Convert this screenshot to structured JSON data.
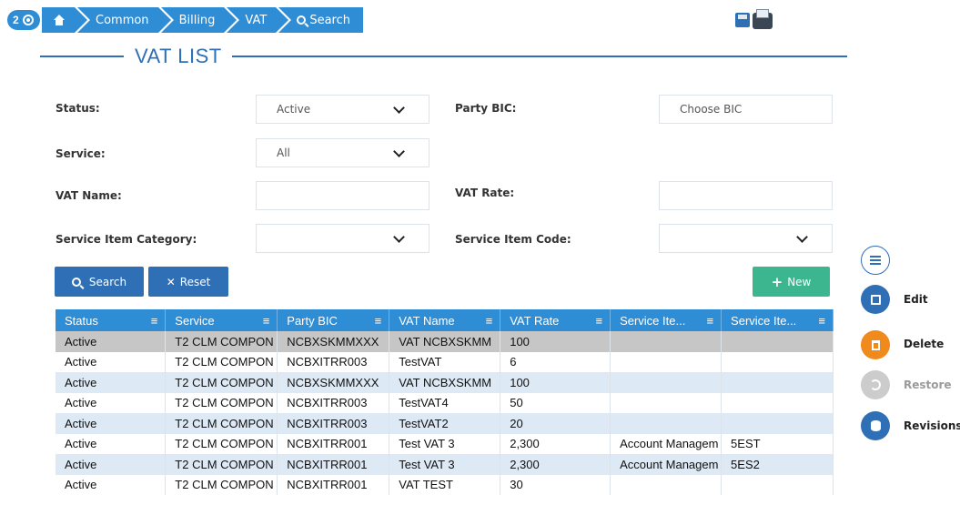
{
  "badge": {
    "count": "2"
  },
  "breadcrumb": {
    "items": [
      "Common",
      "Billing",
      "VAT"
    ],
    "last": "Search"
  },
  "page_title": "VAT LIST",
  "form": {
    "status": {
      "label": "Status:",
      "value": "Active"
    },
    "party_bic": {
      "label": "Party BIC:",
      "placeholder": "Choose BIC"
    },
    "service": {
      "label": "Service:",
      "value": "All"
    },
    "vat_name": {
      "label": "VAT Name:",
      "value": ""
    },
    "vat_rate": {
      "label": "VAT Rate:",
      "value": ""
    },
    "service_item_category": {
      "label": "Service Item Category:",
      "value": ""
    },
    "service_item_code": {
      "label": "Service Item Code:",
      "value": ""
    }
  },
  "buttons": {
    "search": "Search",
    "reset": "Reset",
    "new": "New"
  },
  "table": {
    "headers": [
      "Status",
      "Service",
      "Party BIC",
      "VAT Name",
      "VAT Rate",
      "Service Ite...",
      "Service Ite..."
    ],
    "rows": [
      [
        "Active",
        "T2 CLM COMPON",
        "NCBXSKMMXXX",
        "VAT NCBXSKMM",
        "100",
        "",
        ""
      ],
      [
        "Active",
        "T2 CLM COMPON",
        "NCBXITRR003",
        "TestVAT",
        "6",
        "",
        ""
      ],
      [
        "Active",
        "T2 CLM COMPON",
        "NCBXSKMMXXX",
        "VAT NCBXSKMM",
        "100",
        "",
        ""
      ],
      [
        "Active",
        "T2 CLM COMPON",
        "NCBXITRR003",
        "TestVAT4",
        "50",
        "",
        ""
      ],
      [
        "Active",
        "T2 CLM COMPON",
        "NCBXITRR003",
        "TestVAT2",
        "20",
        "",
        ""
      ],
      [
        "Active",
        "T2 CLM COMPON",
        "NCBXITRR001",
        "Test VAT 3",
        "2,300",
        "Account Managem",
        "5EST"
      ],
      [
        "Active",
        "T2 CLM COMPON",
        "NCBXITRR001",
        "Test VAT 3",
        "2,300",
        "Account Managem",
        "5ES2"
      ],
      [
        "Active",
        "T2 CLM COMPON",
        "NCBXITRR001",
        "VAT TEST",
        "30",
        "",
        ""
      ]
    ]
  },
  "side_actions": {
    "edit": "Edit",
    "delete": "Delete",
    "restore": "Restore",
    "revisions": "Revisions"
  },
  "colors": {
    "primary": "#2f6fb5",
    "header": "#2f8dd6",
    "new_button": "#3cb68f",
    "delete": "#f08a1c",
    "disabled": "#cccccc"
  }
}
